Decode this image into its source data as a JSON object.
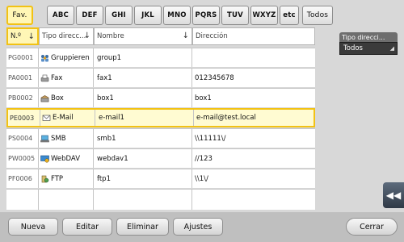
{
  "tabs": [
    {
      "label": "Fav.",
      "active": true
    },
    {
      "label": "ABC"
    },
    {
      "label": "DEF"
    },
    {
      "label": "GHI"
    },
    {
      "label": "JKL"
    },
    {
      "label": "MNO"
    },
    {
      "label": "PQRS"
    },
    {
      "label": "TUV"
    },
    {
      "label": "WXYZ"
    },
    {
      "label": "etc"
    },
    {
      "label": "Todos"
    }
  ],
  "table": {
    "headers": {
      "num": "N.º",
      "type": "Tipo direcc...",
      "name": "Nombre",
      "address": "Dirección"
    },
    "rows": [
      {
        "num": "PG0001",
        "icon": "group-icon",
        "type": "Gruppieren",
        "name": "group1",
        "address": ""
      },
      {
        "num": "PA0001",
        "icon": "fax-icon",
        "type": "Fax",
        "name": "fax1",
        "address": "012345678"
      },
      {
        "num": "PB0002",
        "icon": "box-icon",
        "type": "Box",
        "name": "box1",
        "address": "box1"
      },
      {
        "num": "PE0003",
        "icon": "email-icon",
        "type": "E-Mail",
        "name": "e-mail1",
        "address": "e-mail@test.local",
        "selected": true
      },
      {
        "num": "PS0004",
        "icon": "smb-icon",
        "type": "SMB",
        "name": "smb1",
        "address": "\\\\11111\\/"
      },
      {
        "num": "PW0005",
        "icon": "webdav-icon",
        "type": "WebDAV",
        "name": "webdav1",
        "address": "//123"
      },
      {
        "num": "PF0006",
        "icon": "ftp-icon",
        "type": "FTP",
        "name": "ftp1",
        "address": "\\\\1\\/"
      }
    ]
  },
  "filter": {
    "label": "Tipo direcci...",
    "value": "Todos"
  },
  "side_button": {
    "label": "◀◀"
  },
  "bottom": {
    "nueva": "Nueva",
    "editar": "Editar",
    "eliminar": "Eliminar",
    "ajustes": "Ajustes",
    "cerrar": "Cerrar"
  },
  "colors": {
    "accent": "#f2c214",
    "selected_bg": "#fffbd2",
    "background": "#d8d8d8"
  }
}
